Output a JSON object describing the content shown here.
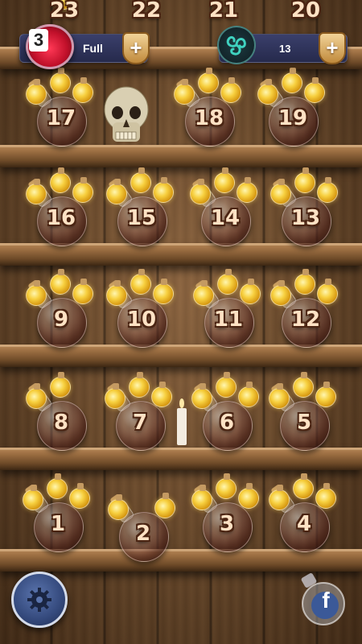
{
  "hud": {
    "lives_count": "3",
    "lives_status": "Full",
    "coins_count": "13",
    "add_lives_label": "+",
    "add_coins_label": "+"
  },
  "levels": {
    "l23": "23",
    "l22": "22",
    "l21": "21",
    "l20": "20",
    "l17": "17",
    "l18": "18",
    "l19": "19",
    "l16": "16",
    "l15": "15",
    "l14": "14",
    "l13": "13",
    "l9": "9",
    "l10": "10",
    "l11": "11",
    "l12": "12",
    "l8": "8",
    "l7": "7",
    "l6": "6",
    "l5": "5",
    "l1": "1",
    "l2": "2",
    "l3": "3",
    "l4": "4"
  },
  "footer": {
    "facebook_label": "f"
  },
  "icons": {
    "lives": "heart-potion-icon",
    "coins": "triskele-icon",
    "settings": "gear-icon",
    "social": "facebook-icon"
  },
  "colors": {
    "hud_bg": "#2d3258",
    "number_fill": "#ffe2c4",
    "number_outline": "#4a2412",
    "settings_bg": "#34497c",
    "facebook_blue": "#3b5998"
  }
}
